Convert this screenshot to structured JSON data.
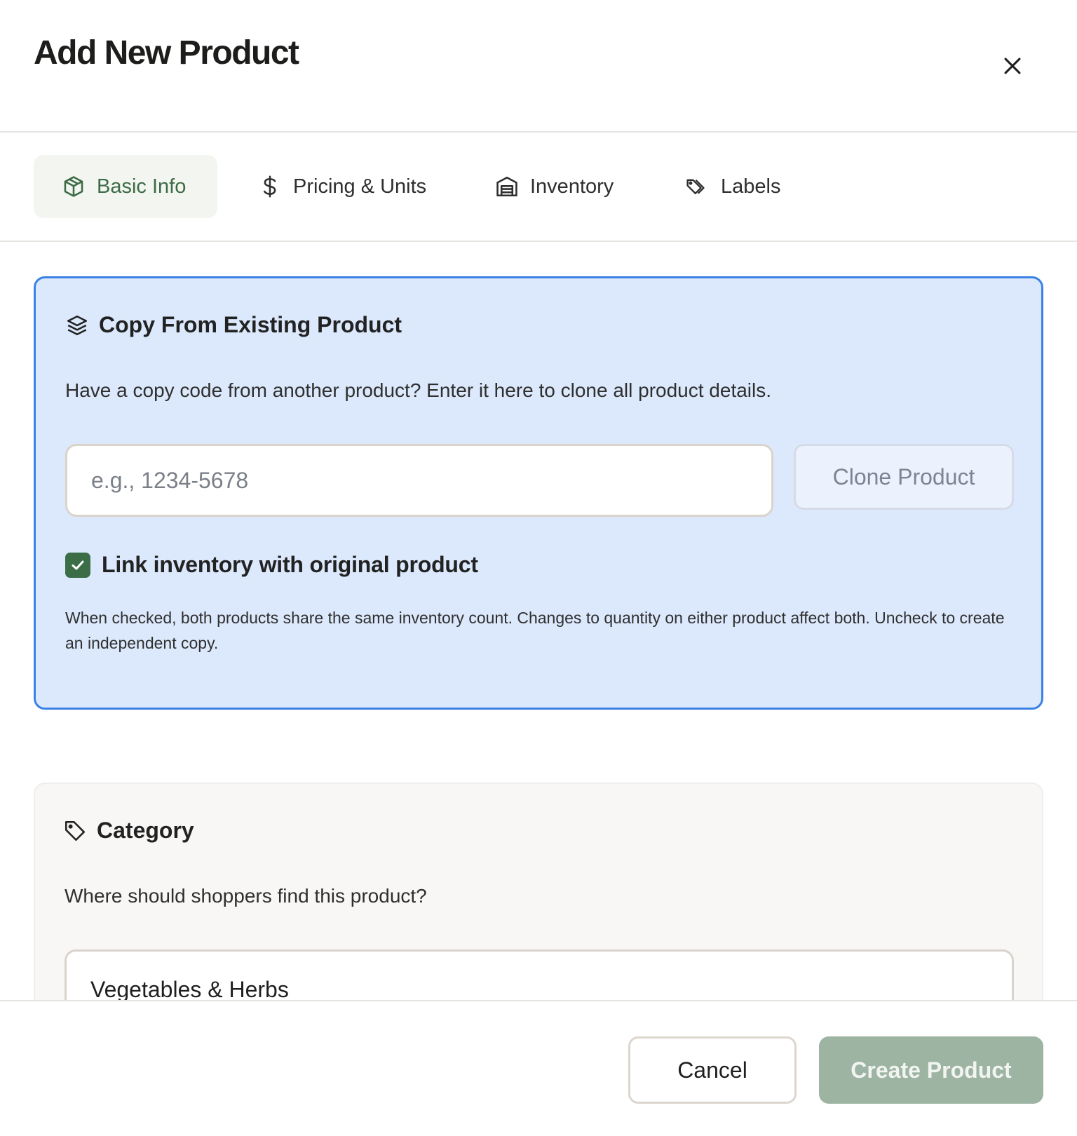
{
  "dialog": {
    "title": "Add New Product"
  },
  "tabs": [
    {
      "label": "Basic Info",
      "icon": "box-icon",
      "active": true
    },
    {
      "label": "Pricing & Units",
      "icon": "dollar-icon",
      "active": false
    },
    {
      "label": "Inventory",
      "icon": "warehouse-icon",
      "active": false
    },
    {
      "label": "Labels",
      "icon": "tags-icon",
      "active": false
    }
  ],
  "copy_panel": {
    "title": "Copy From Existing Product",
    "icon": "layers-icon",
    "description": "Have a copy code from another product? Enter it here to clone all product details.",
    "code_input": {
      "value": "",
      "placeholder": "e.g., 1234-5678"
    },
    "clone_button": "Clone Product",
    "link_inventory": {
      "label": "Link inventory with original product",
      "checked": true,
      "help": "When checked, both products share the same inventory count. Changes to quantity on either product affect both. Uncheck to create an independent copy."
    }
  },
  "category_panel": {
    "title": "Category",
    "icon": "tag-icon",
    "description": "Where should shoppers find this product?",
    "selected": "Vegetables & Herbs"
  },
  "footer": {
    "cancel_label": "Cancel",
    "create_label": "Create Product"
  },
  "colors": {
    "accent_green": "#3b6e46",
    "panel_blue": "#dce9fc",
    "panel_border_blue": "#3a82e6",
    "create_disabled": "#9db4a2"
  }
}
